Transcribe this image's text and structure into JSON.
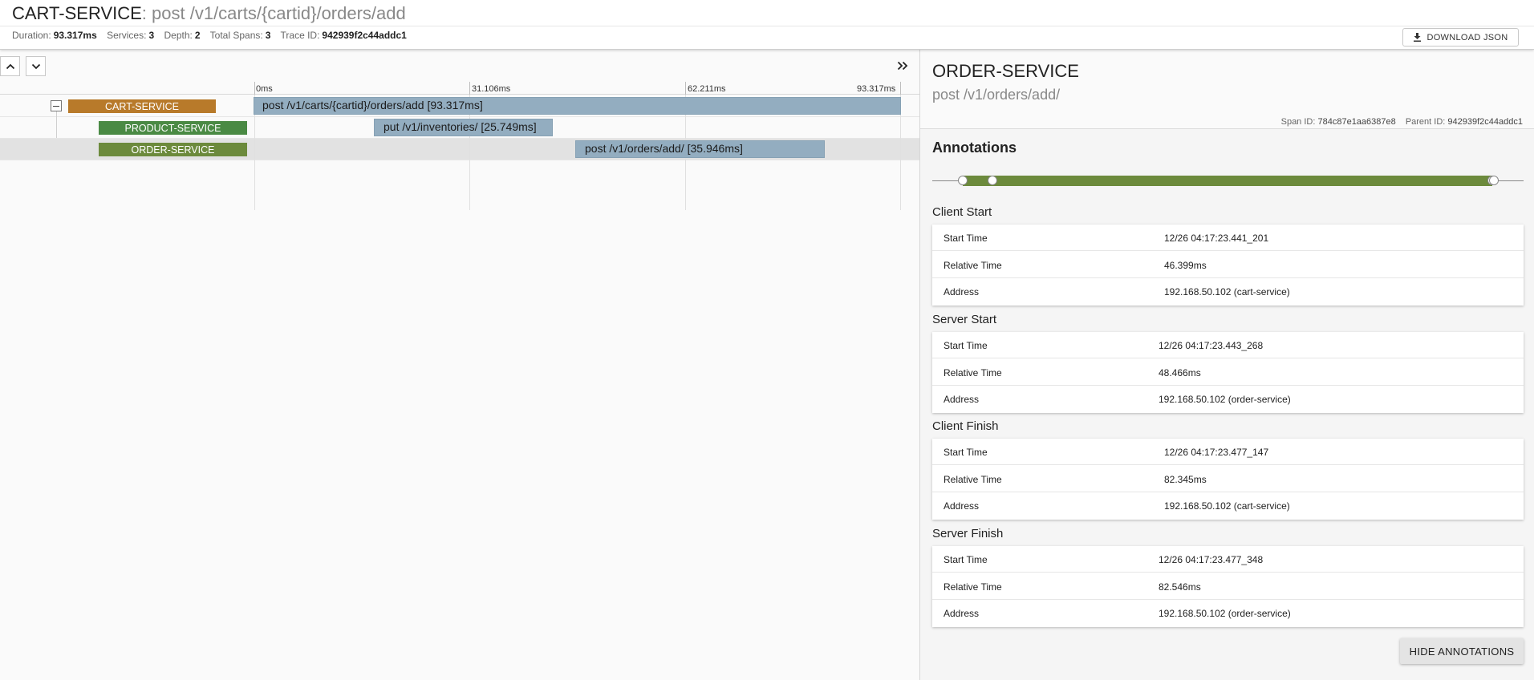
{
  "header": {
    "service": "CART-SERVICE",
    "path": ": post /v1/carts/{cartid}/orders/add",
    "stats": {
      "duration_label": "Duration:",
      "duration": "93.317ms",
      "services_label": "Services:",
      "services": "3",
      "depth_label": "Depth:",
      "depth": "2",
      "spans_label": "Total Spans:",
      "spans": "3",
      "trace_label": "Trace ID:",
      "trace_id": "942939f2c44addc1"
    },
    "download_label": "DOWNLOAD JSON"
  },
  "timeline": {
    "ticks": [
      "0ms",
      "31.106ms",
      "62.211ms",
      "93.317ms"
    ],
    "spans": [
      {
        "service": "CART-SERVICE",
        "label": "post /v1/carts/{cartid}/orders/add [93.317ms]",
        "color": "#b87a2a"
      },
      {
        "service": "PRODUCT-SERVICE",
        "label": "put /v1/inventories/ [25.749ms]",
        "color": "#4a8a44"
      },
      {
        "service": "ORDER-SERVICE",
        "label": "post /v1/orders/add/ [35.946ms]",
        "color": "#6c8a3c"
      }
    ]
  },
  "detail": {
    "service": "ORDER-SERVICE",
    "path": "post /v1/orders/add/",
    "span_id_label": "Span ID:",
    "span_id": "784c87e1aa6387e8",
    "parent_id_label": "Parent ID:",
    "parent_id": "942939f2c44addc1",
    "annotations_title": "Annotations",
    "sections": [
      {
        "title": "Client Start",
        "rows": [
          {
            "k": "Start Time",
            "v": "12/26 04:17:23.441_201"
          },
          {
            "k": "Relative Time",
            "v": "46.399ms"
          },
          {
            "k": "Address",
            "v": "192.168.50.102 (cart-service)"
          }
        ]
      },
      {
        "title": "Server Start",
        "rows": [
          {
            "k": "Start Time",
            "v": "12/26 04:17:23.443_268"
          },
          {
            "k": "Relative Time",
            "v": "48.466ms"
          },
          {
            "k": "Address",
            "v": "192.168.50.102 (order-service)"
          }
        ]
      },
      {
        "title": "Client Finish",
        "rows": [
          {
            "k": "Start Time",
            "v": "12/26 04:17:23.477_147"
          },
          {
            "k": "Relative Time",
            "v": "82.345ms"
          },
          {
            "k": "Address",
            "v": "192.168.50.102 (cart-service)"
          }
        ]
      },
      {
        "title": "Server Finish",
        "rows": [
          {
            "k": "Start Time",
            "v": "12/26 04:17:23.477_348"
          },
          {
            "k": "Relative Time",
            "v": "82.546ms"
          },
          {
            "k": "Address",
            "v": "192.168.50.102 (order-service)"
          }
        ]
      }
    ],
    "hide_label": "HIDE ANNOTATIONS"
  }
}
